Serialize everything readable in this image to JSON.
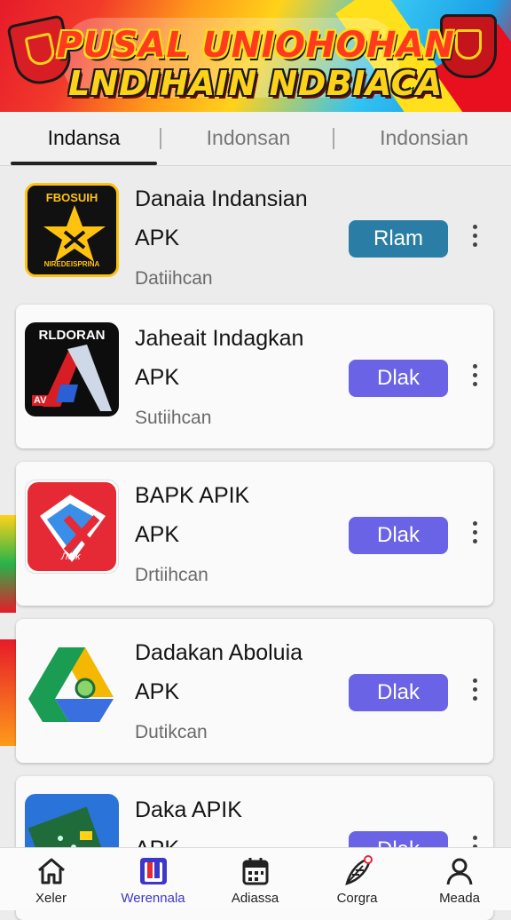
{
  "banner": {
    "line1": "PUSAL UNIOHOHAN",
    "line2": "LNDIHAIN NDBIACA"
  },
  "tabs": [
    {
      "label": "Indansa",
      "active": true
    },
    {
      "label": "Indonsan",
      "active": false
    },
    {
      "label": "Indonsian",
      "active": false
    }
  ],
  "apps": [
    {
      "name": "Danaia Indansian",
      "type": "APK",
      "subtitle": "Datiihcan",
      "action": "Rlam",
      "action_color": "#2a7ea6",
      "icon": "gold-star-emblem-icon",
      "icon_text_top": "FBOSUIH",
      "icon_text_bottom": "NIREDEISPRINA"
    },
    {
      "name": "Jaheait Indagkan",
      "type": "APK",
      "subtitle": "Sutiihcan",
      "action": "Dlak",
      "action_color": "#6a63e6",
      "icon": "blade-emblem-icon",
      "icon_text_top": "RLDORAN",
      "icon_text_bottom": "AV"
    },
    {
      "name": "BAPK APIK",
      "type": "APK",
      "subtitle": "Drtiihcan",
      "action": "Dlak",
      "action_color": "#6a63e6",
      "icon": "red-blue-cube-icon",
      "icon_text_bottom": "Лolk"
    },
    {
      "name": "Dadakan Aboluia",
      "type": "APK",
      "subtitle": "Dutikcan",
      "action": "Dlak",
      "action_color": "#6a63e6",
      "icon": "drive-triangle-icon"
    },
    {
      "name": "Daka APIK",
      "type": "APK",
      "subtitle": "",
      "action": "Dlak",
      "action_color": "#6a63e6",
      "icon": "circuit-board-icon"
    }
  ],
  "bottom_nav": [
    {
      "label": "Xeler",
      "icon": "home-icon",
      "active": false
    },
    {
      "label": "Werennala",
      "icon": "app-window-icon",
      "active": true
    },
    {
      "label": "Adiassa",
      "icon": "calendar-icon",
      "active": false
    },
    {
      "label": "Corgra",
      "icon": "feather-icon",
      "active": false
    },
    {
      "label": "Meada",
      "icon": "person-icon",
      "active": false
    }
  ]
}
